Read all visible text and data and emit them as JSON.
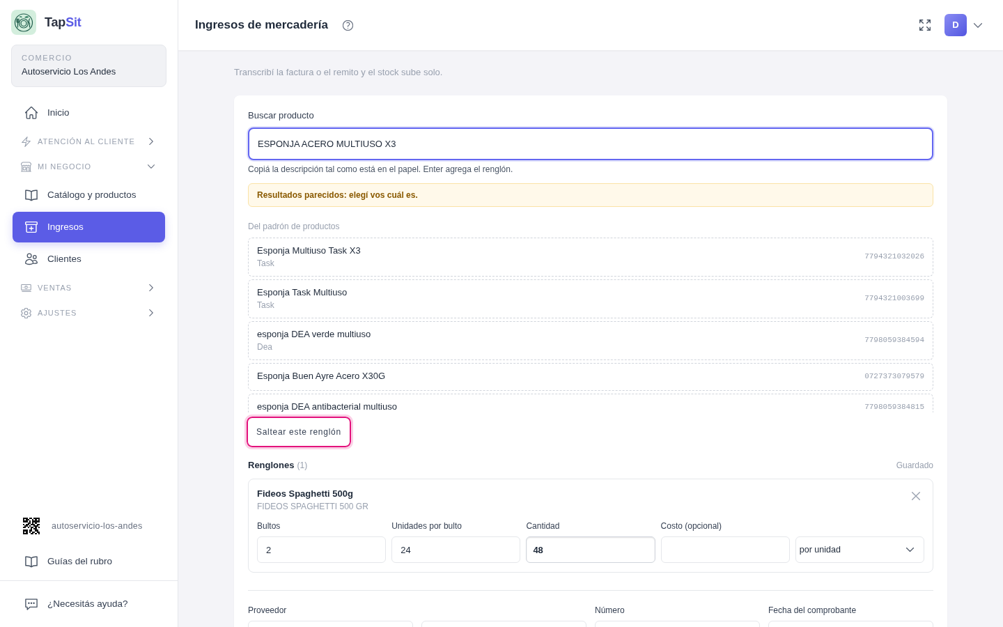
{
  "sidebar": {
    "brand": {
      "name": "Tap",
      "accent": "Sit"
    },
    "store": {
      "label": "COMERCIO",
      "name": "Autoservicio Los Andes"
    },
    "nav": [
      {
        "kind": "link",
        "label": "Inicio",
        "selected": false
      },
      {
        "kind": "section",
        "label": "ATENCIÓN AL CLIENTE",
        "expanded": false
      },
      {
        "kind": "section",
        "label": "MI NEGOCIO",
        "expanded": true,
        "children": [
          {
            "kind": "link",
            "label": "Catálogo y productos",
            "selected": false
          },
          {
            "kind": "link",
            "label": "Ingresos",
            "selected": true
          },
          {
            "kind": "link",
            "label": "Clientes",
            "selected": false
          }
        ]
      },
      {
        "kind": "section",
        "label": "VENTAS",
        "expanded": false
      },
      {
        "kind": "section",
        "label": "AJUSTES",
        "expanded": false
      }
    ],
    "footer": [
      {
        "kind": "qr",
        "label": "autoservicio-los-andes"
      },
      {
        "kind": "link",
        "label": "Guías del rubro"
      }
    ],
    "help": "¿Necesitás ayuda?"
  },
  "header": {
    "title": "Ingresos de mercadería",
    "avatar": "D"
  },
  "subtitle": "Transcribí la factura o el remito y el stock sube solo.",
  "search": {
    "label": "Buscar producto",
    "value": "ESPONJA ACERO MULTIUSO X3",
    "focused": true,
    "hint": "Copiá la descripción tal como está en el papel. Enter agrega el renglón."
  },
  "notice": "Resultados parecidos: elegí vos cuál es.",
  "results": {
    "title": "Del padrón de productos",
    "items": [
      {
        "name": "Esponja Multiuso Task X3",
        "brand": "Task",
        "barcode": "7794321032026"
      },
      {
        "name": "Esponja Task Multiuso",
        "brand": "Task",
        "barcode": "7794321003699"
      },
      {
        "name": "esponja DEA verde multiuso",
        "brand": "Dea",
        "barcode": "7798059384594"
      },
      {
        "name": "Esponja Buen Ayre Acero X30G",
        "barcode": "0727373079579"
      },
      {
        "name": "esponja DEA antibacterial multiuso",
        "barcode": "7798059384815"
      }
    ]
  },
  "skip_button": "Saltear este renglón",
  "lines": {
    "title": "Renglones",
    "count": "(1)",
    "status": "Guardado",
    "items": [
      {
        "name": "Fideos Spaghetti 500g",
        "source": "FIDEOS SPAGHETTI 500 GR",
        "fields": [
          {
            "kind": "input",
            "label": "Bultos",
            "value": "2",
            "highlighted": false
          },
          {
            "kind": "input",
            "label": "Unidades por bulto",
            "value": "24",
            "highlighted": false
          },
          {
            "kind": "input",
            "label": "Cantidad",
            "value": "48",
            "highlighted": true
          },
          {
            "kind": "input",
            "label": "Costo (opcional)",
            "highlighted": false
          },
          {
            "kind": "select",
            "value": "por unidad"
          }
        ]
      }
    ]
  },
  "voucher": {
    "fields": [
      {
        "kind": "double",
        "label": "Proveedor"
      },
      {
        "kind": "single",
        "label": "Número"
      },
      {
        "kind": "single",
        "label": "Fecha del comprobante"
      }
    ]
  }
}
